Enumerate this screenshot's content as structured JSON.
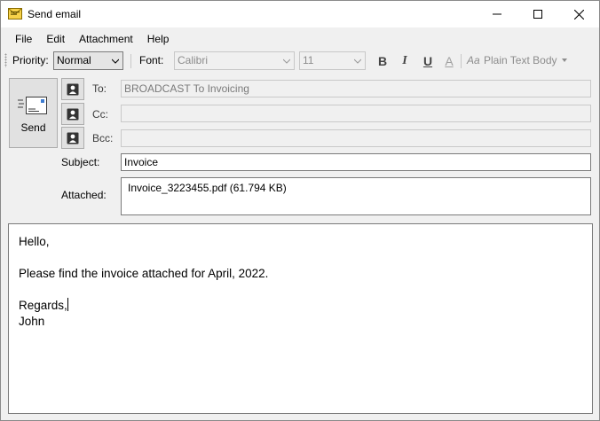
{
  "window": {
    "title": "Send email"
  },
  "menu": {
    "items": [
      "File",
      "Edit",
      "Attachment",
      "Help"
    ]
  },
  "toolbar": {
    "priority_label": "Priority:",
    "priority_value": "Normal",
    "font_label": "Font:",
    "font_value": "Calibri",
    "size_value": "11",
    "bold_label": "B",
    "italic_label": "I",
    "underline_label": "U",
    "color_label": "A",
    "body_style_icon": "Aa",
    "body_style_value": "Plain Text Body"
  },
  "send": {
    "label": "Send"
  },
  "fields": {
    "to_label": "To:",
    "to_value": "BROADCAST To Invoicing",
    "cc_label": "Cc:",
    "cc_value": "",
    "bcc_label": "Bcc:",
    "bcc_value": "",
    "subject_label": "Subject:",
    "subject_value": "Invoice",
    "attached_label": "Attached:",
    "attachment": "Invoice_3223455.pdf (61.794 KB)"
  },
  "body": {
    "lines": [
      "Hello,",
      "",
      "Please find the invoice attached for April, 2022.",
      "",
      "Regards,",
      "John"
    ]
  },
  "icons": {
    "app": "envelope-icon",
    "send": "send-mail-icon",
    "contact": "contact-card-icon"
  }
}
